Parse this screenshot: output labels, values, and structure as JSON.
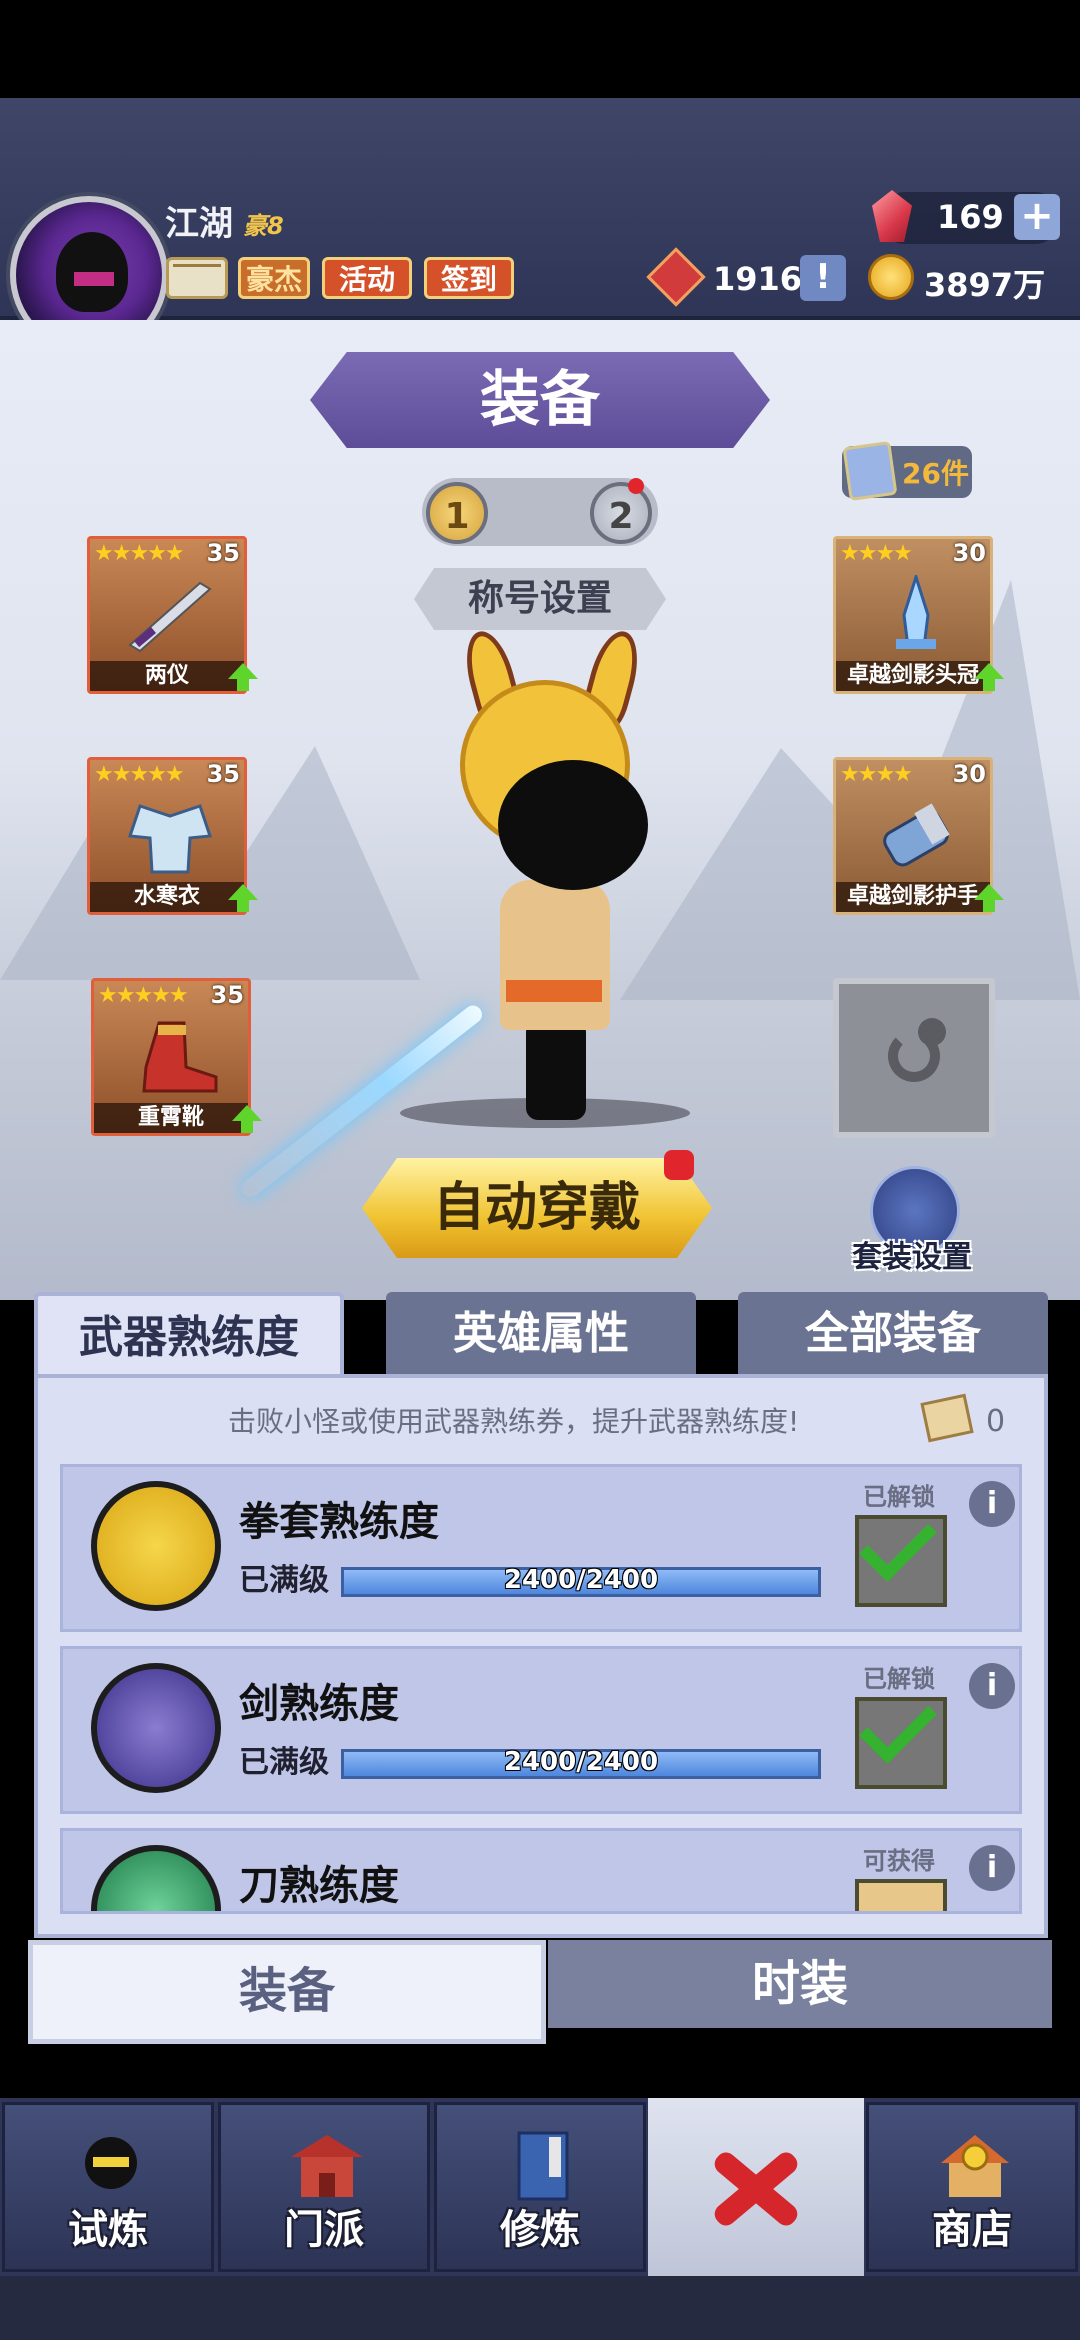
{
  "header": {
    "player_name": "江湖",
    "vip": "豪8",
    "buttons": {
      "hero": "豪杰",
      "activity": "活动",
      "signin": "签到"
    },
    "gems": "169",
    "gem_plus": "+",
    "honor": "1916",
    "honor_plus": "!",
    "coins": "3897万"
  },
  "scene": {
    "title": "装备",
    "page_tabs": [
      "1",
      "2"
    ],
    "bag_count": "26件",
    "title_setting": "称号设置",
    "slots": [
      {
        "name": "两仪",
        "stars": "★★★★★",
        "level": "35"
      },
      {
        "name": "水寒衣",
        "stars": "★★★★★",
        "level": "35"
      },
      {
        "name": "重霄靴",
        "stars": "★★★★★",
        "level": "35"
      },
      {
        "name": "卓越剑影头冠",
        "stars": "★★★★",
        "level": "30"
      },
      {
        "name": "卓越剑影护手",
        "stars": "★★★★",
        "level": "30"
      }
    ],
    "auto_equip": "自动穿戴",
    "suit_setting": "套装设置"
  },
  "panel": {
    "tabs": [
      "武器熟练度",
      "英雄属性",
      "全部装备"
    ],
    "hint": "击败小怪或使用武器熟练券，提升武器熟练度!",
    "ticket_count": "0",
    "cards": [
      {
        "title": "拳套熟练度",
        "level": "已满级",
        "progress": "2400/2400",
        "status": "已解锁",
        "info": "i"
      },
      {
        "title": "剑熟练度",
        "level": "已满级",
        "progress": "2400/2400",
        "status": "已解锁",
        "info": "i"
      },
      {
        "title": "刀熟练度",
        "status": "可获得",
        "info": "i"
      }
    ]
  },
  "bottom_tabs": {
    "equip": "装备",
    "fashion": "时装"
  },
  "nav": [
    "试炼",
    "门派",
    "修炼",
    "商店"
  ],
  "colors": {
    "accent_purple": "#5d4d98",
    "gold": "#f0c331",
    "progress_blue": "#4e87de",
    "nav_bg": "#2f3556"
  }
}
